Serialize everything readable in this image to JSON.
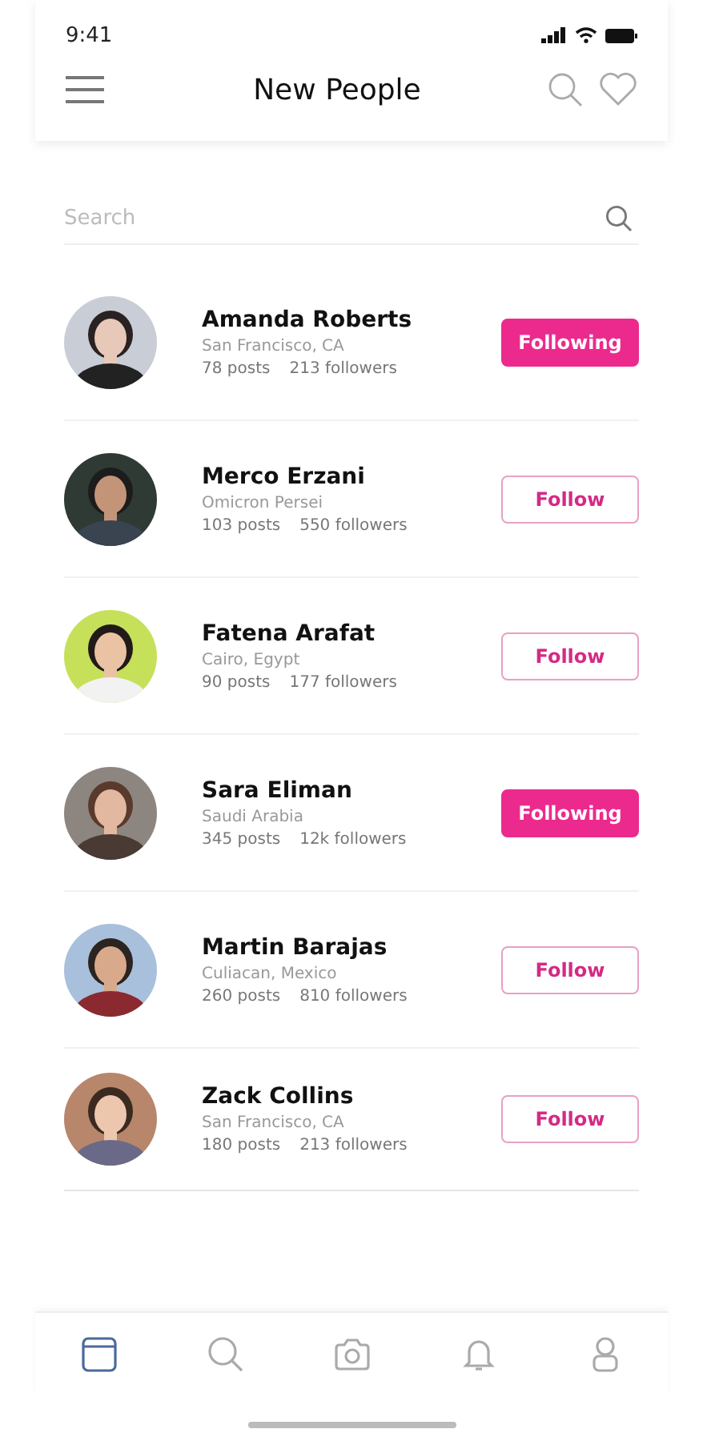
{
  "status_bar": {
    "time": "9:41"
  },
  "header": {
    "title": "New People"
  },
  "search": {
    "placeholder": "Search"
  },
  "people": [
    {
      "name": "Amanda Roberts",
      "location": "San Francisco, CA",
      "posts": "78 posts",
      "followers": "213 followers",
      "button": "Following",
      "selected": true
    },
    {
      "name": "Merco Erzani",
      "location": "Omicron Persei",
      "posts": "103 posts",
      "followers": "550 followers",
      "button": "Follow",
      "selected": false
    },
    {
      "name": "Fatena Arafat",
      "location": "Cairo, Egypt",
      "posts": "90 posts",
      "followers": "177 followers",
      "button": "Follow",
      "selected": false
    },
    {
      "name": "Sara Eliman",
      "location": "Saudi Arabia",
      "posts": "345 posts",
      "followers": "12k followers",
      "button": "Following",
      "selected": true
    },
    {
      "name": "Martin Barajas",
      "location": "Culiacan, Mexico",
      "posts": "260 posts",
      "followers": "810 followers",
      "button": "Follow",
      "selected": false
    },
    {
      "name": "Zack Collins",
      "location": "San Francisco, CA",
      "posts": "180 posts",
      "followers": "213 followers",
      "button": "Follow",
      "selected": false
    }
  ],
  "tabs": [
    {
      "kind": "home",
      "selected": true
    },
    {
      "kind": "search",
      "selected": false
    },
    {
      "kind": "camera",
      "selected": false
    },
    {
      "kind": "bell",
      "selected": false
    },
    {
      "kind": "profile",
      "selected": false
    }
  ]
}
